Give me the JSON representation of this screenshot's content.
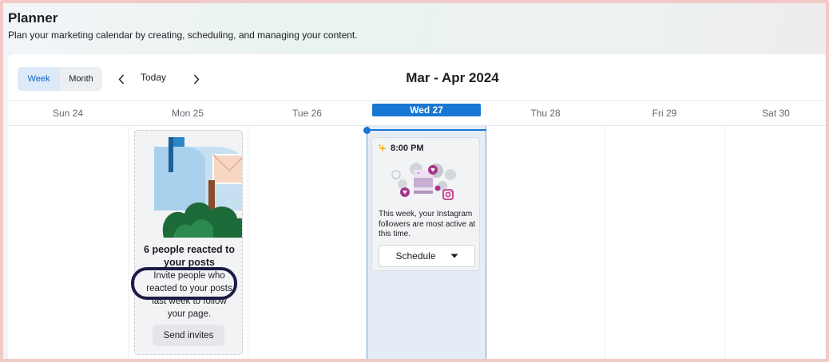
{
  "page": {
    "title": "Planner",
    "subtitle": "Plan your marketing calendar by creating, scheduling, and managing your content."
  },
  "toolbar": {
    "week_label": "Week",
    "month_label": "Month",
    "today_label": "Today",
    "range_title": "Mar - Apr 2024",
    "active_view": "Week"
  },
  "days": [
    {
      "label": "Sun 24"
    },
    {
      "label": "Mon 25"
    },
    {
      "label": "Tue 26"
    },
    {
      "label": "Wed 27",
      "current": true
    },
    {
      "label": "Thu 28"
    },
    {
      "label": "Fri 29"
    },
    {
      "label": "Sat 30"
    }
  ],
  "invite_card": {
    "heading": "6 people reacted to your posts",
    "body": "Invite people who reacted to your posts last week to follow your page.",
    "button_label": "Send invites"
  },
  "insight_card": {
    "time": "8:00 PM",
    "text": "This week, your Instagram followers are most active at this time.",
    "button_label": "Schedule"
  },
  "colors": {
    "accent": "#1877d2",
    "highlight_ring": "#1d1a46",
    "frame_border": "#f1c9c6"
  }
}
